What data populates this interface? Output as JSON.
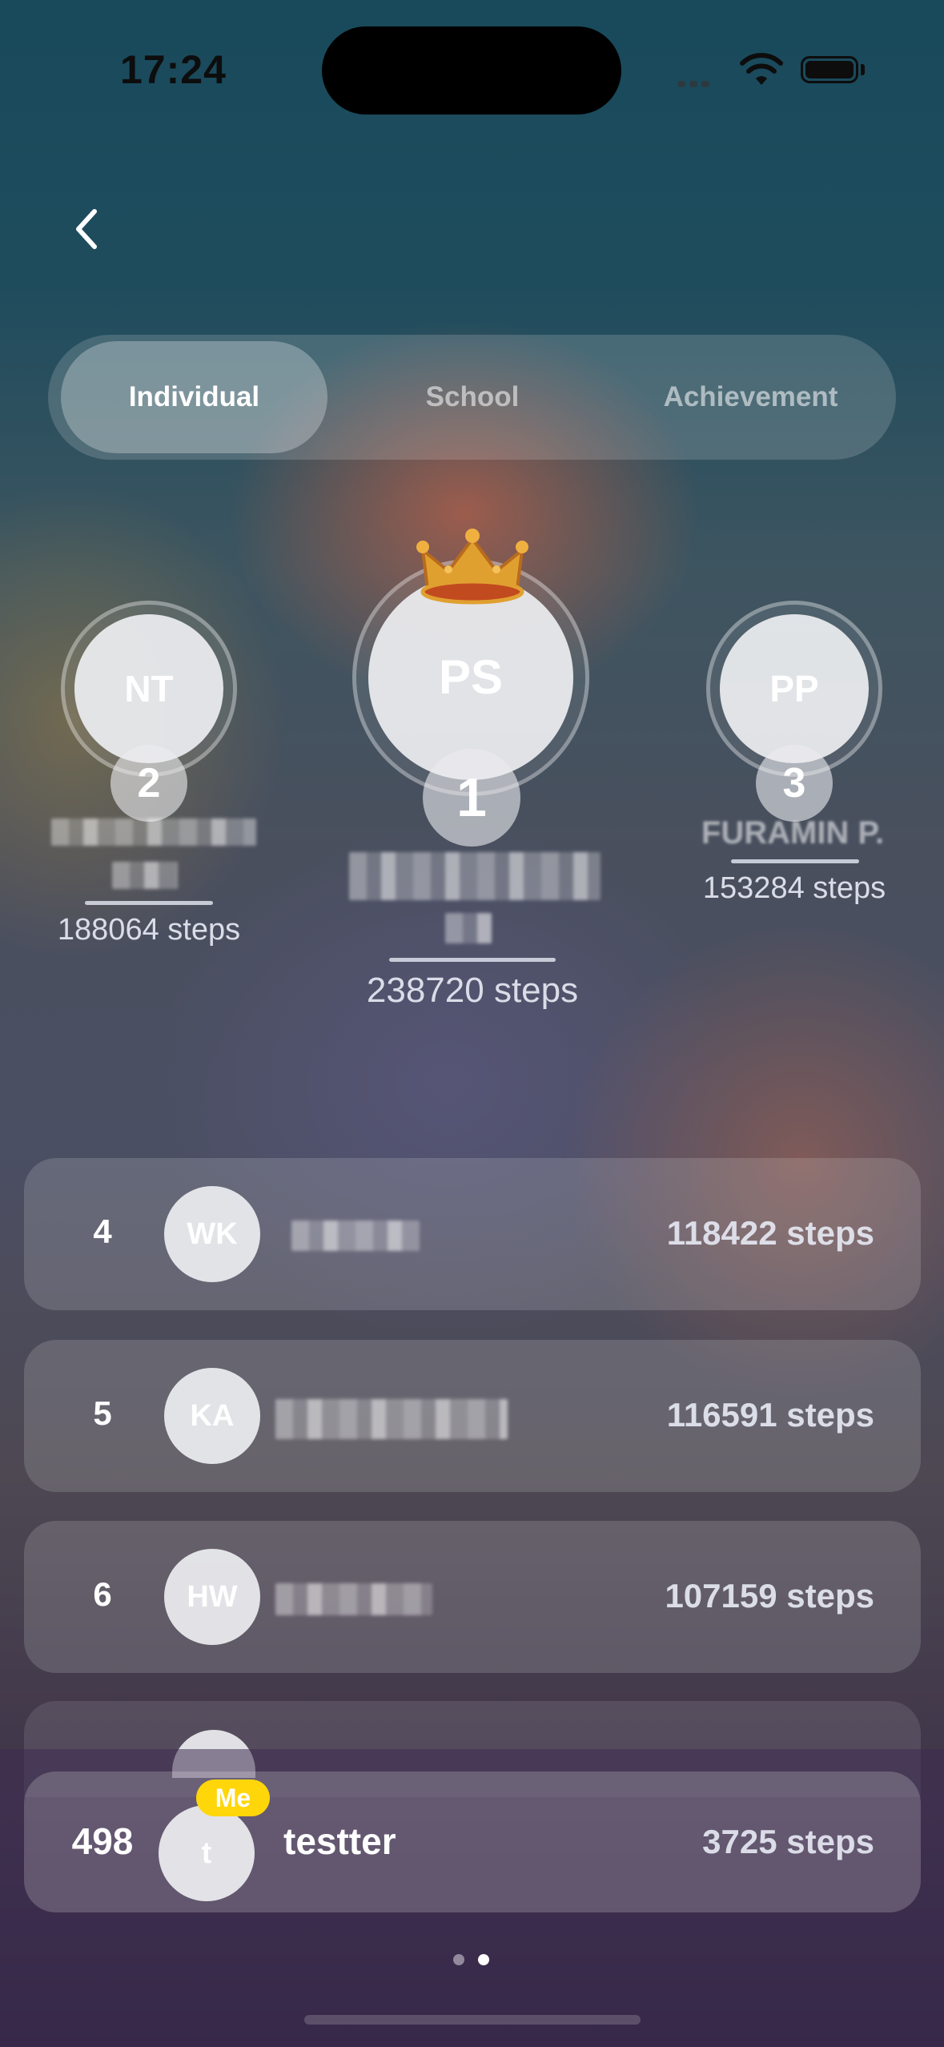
{
  "status_bar": {
    "time": "17:24"
  },
  "tabs": [
    {
      "label": "Individual",
      "active": true
    },
    {
      "label": "School",
      "active": false
    },
    {
      "label": "Achievement",
      "active": false
    }
  ],
  "podium": {
    "first": {
      "initials": "PS",
      "rank": "1",
      "steps": "238720 steps"
    },
    "second": {
      "initials": "NT",
      "rank": "2",
      "steps": "188064 steps"
    },
    "third": {
      "initials": "PP",
      "rank": "3",
      "name_partial": "FURAMIN P.",
      "steps": "153284 steps"
    }
  },
  "leaderboard": [
    {
      "rank": "4",
      "initials": "WK",
      "steps": "118422 steps"
    },
    {
      "rank": "5",
      "initials": "KA",
      "steps": "116591 steps"
    },
    {
      "rank": "6",
      "initials": "HW",
      "steps": "107159 steps"
    }
  ],
  "me": {
    "rank": "498",
    "initials": "t",
    "badge": "Me",
    "name": "testter",
    "steps": "3725 steps"
  },
  "pager": {
    "pages": 2,
    "current": 2
  },
  "colors": {
    "me_badge": "#ffd60a",
    "crown": "#e0a030"
  },
  "icons": [
    "back-chevron-icon",
    "crown-icon",
    "wifi-icon",
    "battery-icon",
    "signal-icon"
  ]
}
